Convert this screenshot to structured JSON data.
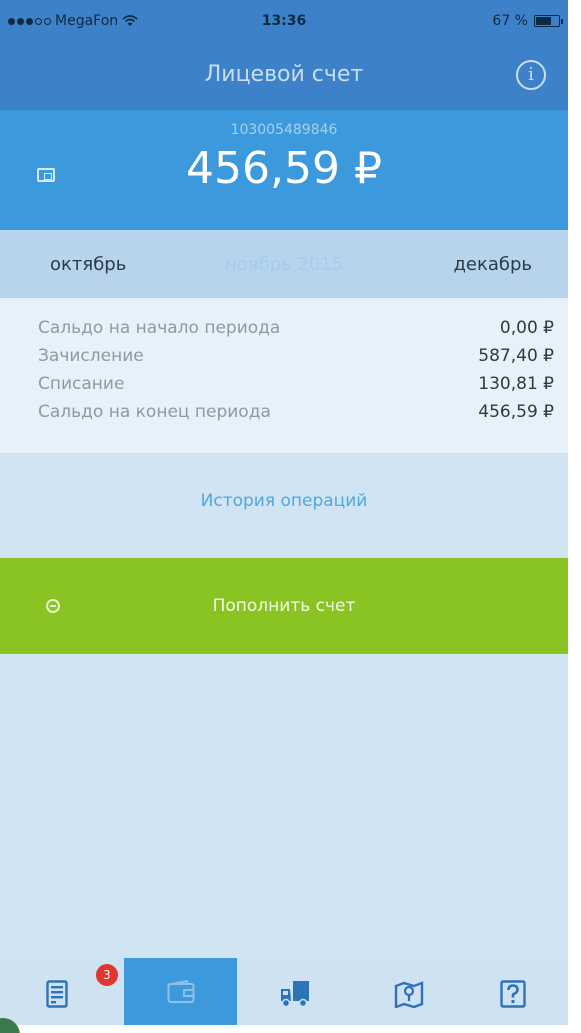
{
  "status_bar": {
    "carrier": "MegaFon",
    "time": "13:36",
    "battery_label": "67 %",
    "battery_level": 0.67
  },
  "nav": {
    "title": "Лицевой счет"
  },
  "balance": {
    "account_number": "103005489846",
    "amount": "456,59 ₽"
  },
  "months": {
    "prev": "октябрь",
    "current": "ноябрь 2015",
    "next": "декабрь"
  },
  "summary": {
    "rows": [
      {
        "label": "Сальдо на начало периода",
        "value": "0,00 ₽"
      },
      {
        "label": "Зачисление",
        "value": "587,40 ₽"
      },
      {
        "label": "Списание",
        "value": "130,81 ₽"
      },
      {
        "label": "Сальдо на конец периода",
        "value": "456,59 ₽"
      }
    ]
  },
  "history": {
    "label": "История операций"
  },
  "topup": {
    "label": "Пополнить счет"
  },
  "tab_bar": {
    "badge_count": "3",
    "tabs": [
      {
        "icon": "document-icon"
      },
      {
        "icon": "wallet-icon"
      },
      {
        "icon": "truck-icon"
      },
      {
        "icon": "map-icon"
      },
      {
        "icon": "help-icon"
      }
    ]
  },
  "colors": {
    "nav": "#3d82c8",
    "balance": "#3c99dc",
    "topup": "#8ac422",
    "badge": "#e0362c"
  }
}
